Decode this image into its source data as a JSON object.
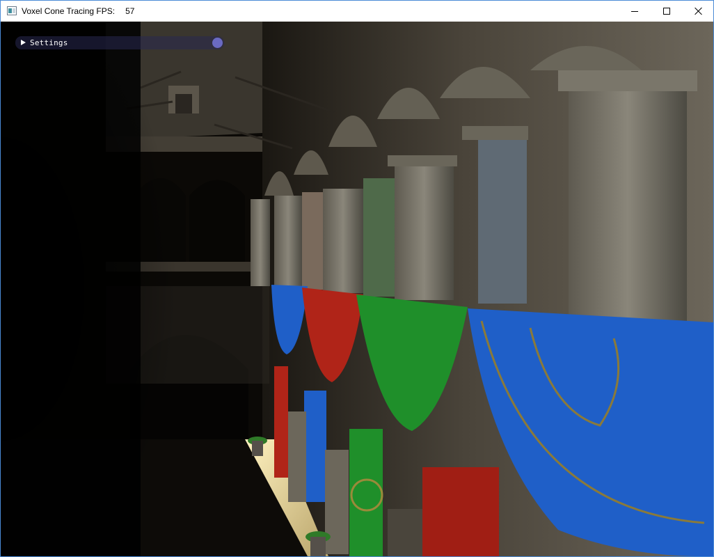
{
  "window": {
    "title": "Voxel Cone Tracing FPS:",
    "fps": "57"
  },
  "icons": {
    "app": "app-window-icon",
    "minimize": "minimize-icon",
    "maximize": "maximize-icon",
    "close": "close-icon",
    "collapse": "triangle-right-icon"
  },
  "overlay": {
    "settings_label": "Settings"
  },
  "colors": {
    "titlebar_bg": "#ffffff",
    "window_border": "#4a8ad6",
    "banner_blue": "#1f5fc8",
    "banner_red": "#b02418",
    "banner_green": "#1f8f2a",
    "panel_grip": "#6a6ac2"
  }
}
